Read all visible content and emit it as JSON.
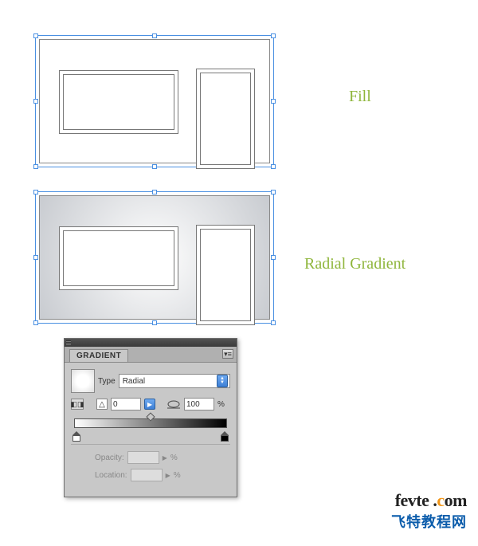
{
  "labels": {
    "fill": "Fill",
    "radial_gradient": "Radial Gradient"
  },
  "panel": {
    "title": "GRADIENT"
  },
  "type": {
    "label": "Type",
    "value": "Radial"
  },
  "angle": {
    "symbol": "△",
    "value": "0"
  },
  "aspect": {
    "value": "100",
    "unit": "%"
  },
  "opacity": {
    "label": "Opacity:",
    "unit": "%"
  },
  "location": {
    "label": "Location:",
    "unit": "%"
  },
  "logo": {
    "line1a": "fevte",
    "line1b": " .",
    "line1c": "c",
    "line1d": "om",
    "line2": "飞特教程网"
  }
}
